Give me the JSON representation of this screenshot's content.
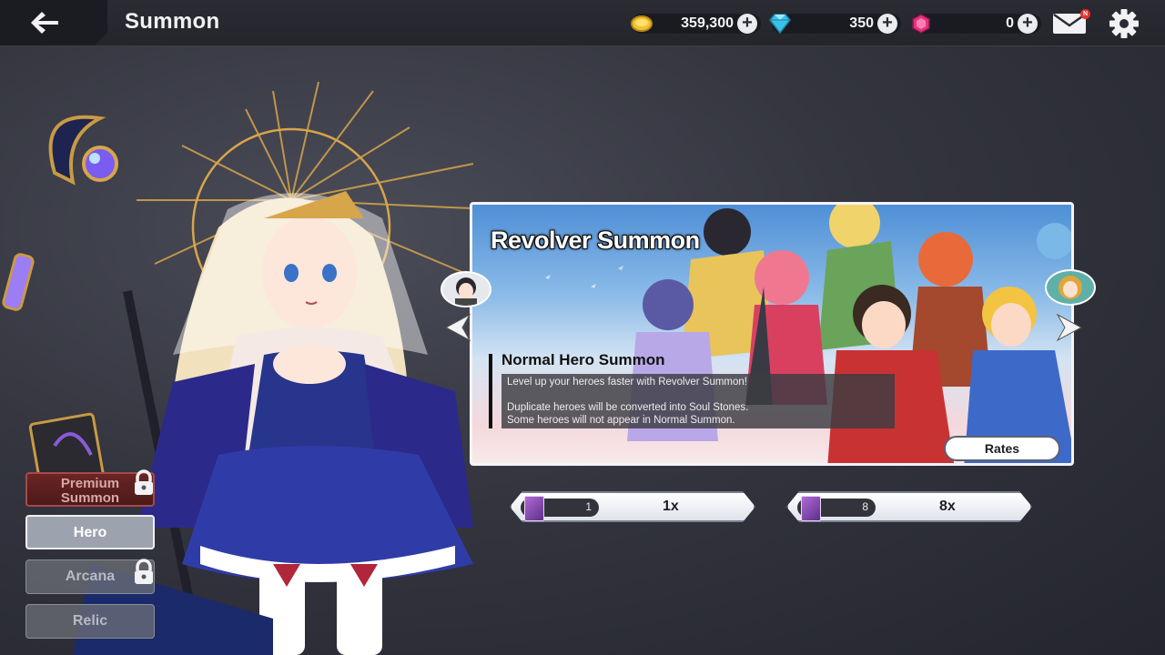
{
  "header": {
    "title": "Summon",
    "gold": "359,300",
    "diamonds": "350",
    "gems": "0",
    "mail_badge": "N"
  },
  "banner": {
    "title": "Revolver Summon",
    "subtitle": "Normal Hero Summon",
    "desc_line1": "Level up your heroes faster with Revolver Summon!",
    "desc_line2": "Duplicate heroes will be converted into Soul Stones.",
    "desc_line3": "Some heroes will not appear in Normal Summon.",
    "rates_label": "Rates"
  },
  "summon_buttons": [
    {
      "cost": "1",
      "label": "1x"
    },
    {
      "cost": "8",
      "label": "8x"
    }
  ],
  "tabs": {
    "premium_line1": "Premium",
    "premium_line2": "Summon",
    "hero": "Hero",
    "arcana": "Arcana",
    "relic": "Relic"
  },
  "icons": [
    "back-arrow-icon",
    "gold-coin-icon",
    "diamond-icon",
    "gem-icon",
    "plus-icon",
    "mail-icon",
    "gear-icon",
    "lock-icon",
    "chevron-left-icon",
    "chevron-right-icon",
    "summon-ticket-icon"
  ],
  "colors": {
    "accent": "#e8302f",
    "gold": "#f2c230",
    "diamond": "#39c3e8",
    "gem": "#e3347c"
  }
}
